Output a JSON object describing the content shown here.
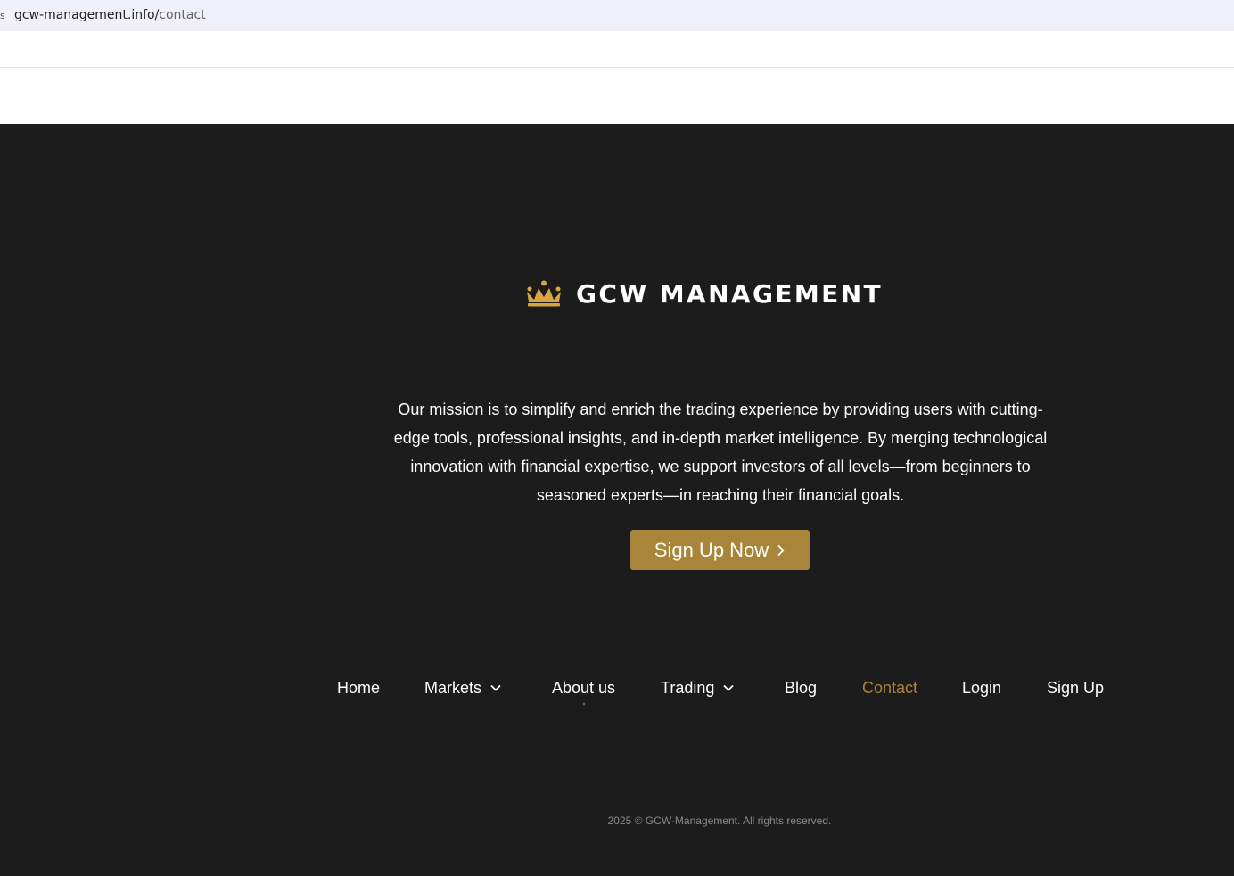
{
  "browser": {
    "url_host": "gcw-management.info/",
    "url_path": "contact"
  },
  "brand": {
    "name": "GCW MANAGEMENT",
    "logo_icon": "crown-icon",
    "accent_color": "#a88539"
  },
  "mission": {
    "text": "Our mission is to simplify and enrich the trading experience by providing users with cutting-edge tools, professional insights, and in-depth market intelligence. By merging technological innovation with financial expertise, we support investors of all levels—from beginners to seasoned experts—in reaching their financial goals."
  },
  "cta": {
    "label": "Sign Up Now",
    "icon": "chevron-right-icon"
  },
  "nav": {
    "items": [
      {
        "label": "Home"
      },
      {
        "label": "Markets",
        "icon": "chevron-down-icon"
      },
      {
        "label": "About us"
      },
      {
        "label": "Trading",
        "icon": "chevron-down-icon"
      },
      {
        "label": "Blog"
      },
      {
        "label": "Contact",
        "active": true
      },
      {
        "label": "Login"
      },
      {
        "label": "Sign Up"
      }
    ]
  },
  "footer": {
    "copyright": "2025 © GCW-Management. All rights reserved."
  }
}
